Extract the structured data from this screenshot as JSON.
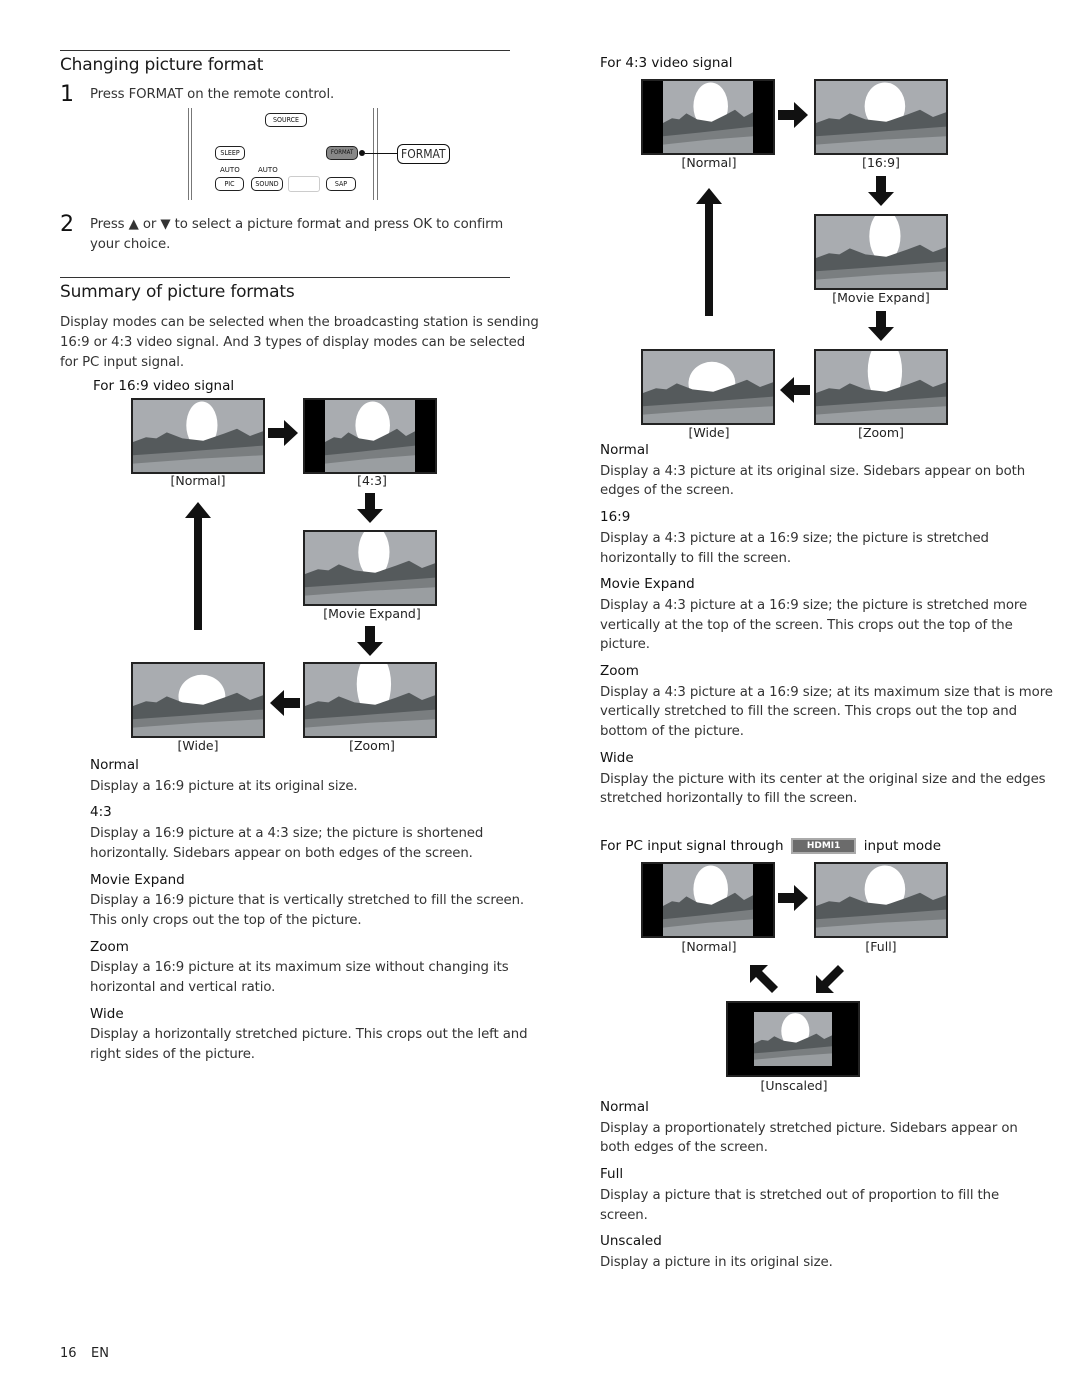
{
  "section1": {
    "title": "Changing picture format",
    "step1": {
      "num": "1",
      "text": "Press FORMAT on the remote control."
    },
    "step2": {
      "num": "2",
      "line1": "Press ▲ or ▼ to select a picture format and press OK to confirm",
      "line2": "your choice."
    },
    "remote": {
      "keys": {
        "source": "SOURCE",
        "sleep": "SLEEP",
        "format": "FORMAT",
        "pic": "PIC",
        "sound": "SOUND",
        "sap": "SAP"
      },
      "labels": {
        "auto1": "AUTO",
        "auto2": "AUTO"
      },
      "callout": "FORMAT"
    }
  },
  "section2": {
    "title": "Summary of picture formats",
    "intro": [
      "Display modes can be selected when the broadcasting station is sending",
      "16:9 or 4:3 video signal. And 3 types of display modes can be selected",
      "for PC input signal."
    ],
    "signal169": {
      "heading": "For 16:9 video signal",
      "captions": {
        "normal": "[Normal]",
        "r43": "[4:3]",
        "movie": "[Movie Expand]",
        "wide": "[Wide]",
        "zoom": "[Zoom]"
      },
      "descriptions": [
        {
          "title": "Normal",
          "lines": [
            "Display a 16:9 picture at its original size."
          ]
        },
        {
          "title": "4:3",
          "lines": [
            "Display a 16:9 picture at a 4:3 size; the picture is shortened",
            "horizontally. Sidebars appear on both edges of the screen."
          ]
        },
        {
          "title": "Movie Expand",
          "lines": [
            "Display a 16:9 picture that is vertically stretched to fill the screen.",
            "This only crops out the top of the picture."
          ]
        },
        {
          "title": "Zoom",
          "lines": [
            "Display a 16:9 picture at its maximum size without changing its",
            "horizontal and vertical ratio."
          ]
        },
        {
          "title": "Wide",
          "lines": [
            "Display a horizontally stretched picture. This crops out the left and",
            "right sides of the picture."
          ]
        }
      ]
    },
    "signal43": {
      "heading": "For 4:3 video signal",
      "captions": {
        "normal": "[Normal]",
        "r169": "[16:9]",
        "movie": "[Movie Expand]",
        "wide": "[Wide]",
        "zoom": "[Zoom]"
      },
      "descriptions": [
        {
          "title": "Normal",
          "lines": [
            "Display a 4:3 picture at its original size. Sidebars appear on both",
            "edges of the screen."
          ]
        },
        {
          "title": "16:9",
          "lines": [
            "Display a 4:3 picture at a 16:9 size; the picture is stretched",
            "horizontally to fill the screen."
          ]
        },
        {
          "title": "Movie Expand",
          "lines": [
            "Display a 4:3 picture at a 16:9 size; the picture is stretched more",
            "vertically at the top of the screen. This crops out the top of the",
            "picture."
          ]
        },
        {
          "title": "Zoom",
          "lines": [
            "Display a 4:3 picture at a 16:9 size; at its maximum size that is more",
            "vertically stretched to fill the screen. This crops out the top and",
            "bottom of the picture."
          ]
        },
        {
          "title": "Wide",
          "lines": [
            "Display the picture with its center at the original size and the edges",
            "stretched horizontally to fill the screen."
          ]
        }
      ]
    },
    "pc": {
      "heading_pre": "For PC input signal through",
      "hdmi_label": "HDMI1",
      "heading_post": "input mode",
      "captions": {
        "normal": "[Normal]",
        "full": "[Full]",
        "unscaled": "[Unscaled]"
      },
      "descriptions": [
        {
          "title": "Normal",
          "lines": [
            "Display a proportionately stretched picture. Sidebars appear on",
            "both edges of the screen."
          ]
        },
        {
          "title": "Full",
          "lines": [
            "Display a picture that is stretched out of proportion to fill the",
            "screen."
          ]
        },
        {
          "title": "Unscaled",
          "lines": [
            "Display a picture in its original size."
          ]
        }
      ]
    }
  },
  "footer": {
    "page": "16",
    "lang": "EN"
  }
}
